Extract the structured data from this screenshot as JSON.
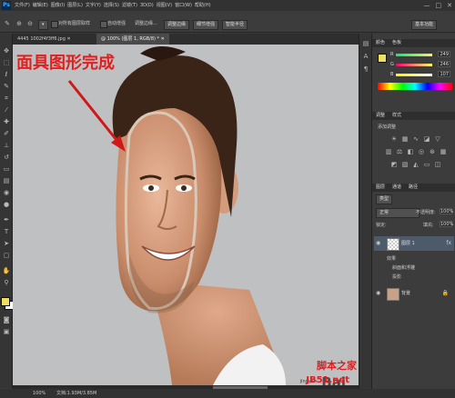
{
  "app": {
    "logo": "Ps"
  },
  "menus": [
    "文件(F)",
    "编辑(E)",
    "图像(I)",
    "图层(L)",
    "文字(Y)",
    "选择(S)",
    "滤镜(T)",
    "3D(D)",
    "视图(V)",
    "窗口(W)",
    "帮助(H)"
  ],
  "window_controls": [
    "—",
    "□",
    "✕"
  ],
  "options": {
    "sample_all": "对所有图层取样",
    "sample_merged": "自动增强",
    "refine_edge": "调整边缘...",
    "btn1": "调整边缘",
    "btn2": "细节增强",
    "btn3": "智能半径",
    "workspace": "基本功能"
  },
  "tabs": {
    "doc1": "4445 1002f4f3ff6.jpg ✕",
    "doc2": "@ 100% (图层 1, RGB/8) * ✕"
  },
  "canvas": {
    "title_annotation": "面具图形完成",
    "watermark_brand": "Bai",
    "watermark_sub": "jingyan",
    "watermark_site": "脚本之家",
    "watermark_url": "JB51.net"
  },
  "status": {
    "zoom": "100%",
    "doc": "文档:1.93M/3.85M"
  },
  "color_panel": {
    "tabs": [
      "颜色",
      "色板"
    ],
    "r": "249",
    "g": "246",
    "b": "107"
  },
  "adjust_panel": {
    "tabs": [
      "调整",
      "样式"
    ],
    "heading": "添加调整"
  },
  "layers_panel": {
    "tabs": [
      "图层",
      "通道",
      "路径"
    ],
    "kind": "类型",
    "blend": "正常",
    "opacity_label": "不透明度:",
    "opacity": "100%",
    "lock": "锁定:",
    "fill_label": "填充:",
    "fill": "100%",
    "layers": [
      {
        "name": "图层 1",
        "effect_heading": "效果",
        "effect": "斜面和浮雕",
        "effect2": "投影"
      },
      {
        "name": "背景"
      }
    ]
  },
  "colors": {
    "foreground": "#f0e060",
    "background": "#ffffff",
    "accent_red": "#e02020"
  }
}
